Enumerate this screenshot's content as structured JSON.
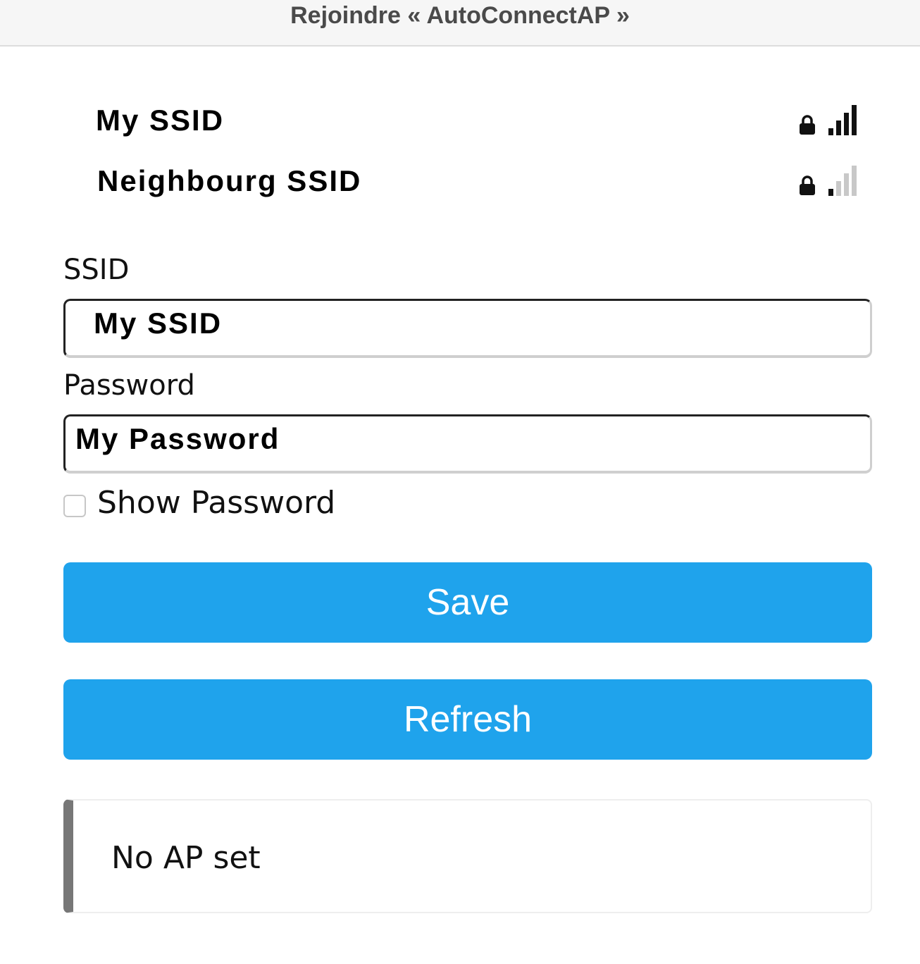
{
  "window": {
    "title": "Rejoindre « AutoConnectAP »"
  },
  "networks": [
    {
      "ssid": "My SSID",
      "lock_icon": "lock-icon",
      "signal_bars": 4,
      "signal_max": 4
    },
    {
      "ssid": "Neighbourg SSID",
      "lock_icon": "lock-icon",
      "signal_bars": 1,
      "signal_max": 4
    }
  ],
  "form": {
    "ssid_label": "SSID",
    "ssid_value": "My SSID",
    "password_label": "Password",
    "password_value": "My Password",
    "show_password_label": "Show Password",
    "show_password_checked": false
  },
  "buttons": {
    "save_label": "Save",
    "refresh_label": "Refresh"
  },
  "status": {
    "message": "No AP set"
  },
  "colors": {
    "button": "#1fa3ec",
    "signal_active": "#111111",
    "signal_inactive": "#c8c8c8",
    "message_border": "#777777"
  }
}
